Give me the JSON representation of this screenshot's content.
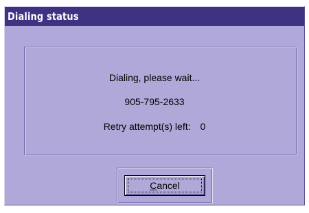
{
  "window": {
    "title": "Dialing status"
  },
  "status": {
    "message": "Dialing, please wait...",
    "phone_number": "905-795-2633",
    "retry_label": "Retry attempt(s) left:",
    "retry_value": "0"
  },
  "buttons": {
    "cancel_mnemonic": "C",
    "cancel_rest": "ancel"
  }
}
